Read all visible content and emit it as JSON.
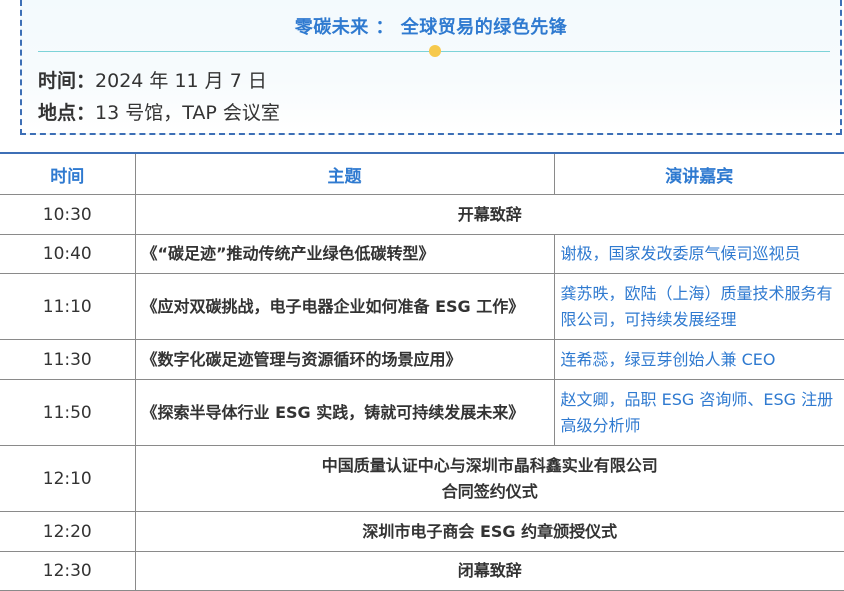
{
  "event": {
    "title": "零碳未来 ： 全球贸易的绿色先锋",
    "time_label": "时间：",
    "time_value": "2024 年 11 月 7 日",
    "place_label": "地点：",
    "place_value": "13 号馆，TAP 会议室"
  },
  "colors": {
    "accent_blue": "#2f7ad0",
    "border_blue": "#3d6fb6",
    "divider_teal": "#7cd3d8",
    "dot_yellow": "#f6c94c"
  },
  "table": {
    "headers": [
      "时间",
      "主题",
      "演讲嘉宾"
    ],
    "rows": [
      {
        "time": "10:30",
        "topic": "开幕致辞",
        "speaker": ""
      },
      {
        "time": "10:40",
        "topic": "《“碳足迹”推动传统产业绿色低碳转型》",
        "speaker": "谢极，国家发改委原气候司巡视员"
      },
      {
        "time": "11:10",
        "topic": "《应对双碳挑战，电子电器企业如何准备 ESG 工作》",
        "speaker": "龚苏昳，欧陆（上海）质量技术服务有限公司，可持续发展经理"
      },
      {
        "time": "11:30",
        "topic": "《数字化碳足迹管理与资源循环的场景应用》",
        "speaker": "连希蕊，绿豆芽创始人兼 CEO"
      },
      {
        "time": "11:50",
        "topic": "《探索半导体行业 ESG 实践，铸就可持续发展未来》",
        "speaker": "赵文卿，品职 ESG 咨询师、ESG 注册高级分析师"
      },
      {
        "time": "12:10",
        "topic": "中国质量认证中心与深圳市晶科鑫实业有限公司",
        "topic_line2": "合同签约仪式",
        "speaker": ""
      },
      {
        "time": "12:20",
        "topic": "深圳市电子商会 ESG 约章颁授仪式",
        "speaker": ""
      },
      {
        "time": "12:30",
        "topic": "闭幕致辞",
        "speaker": ""
      }
    ]
  }
}
